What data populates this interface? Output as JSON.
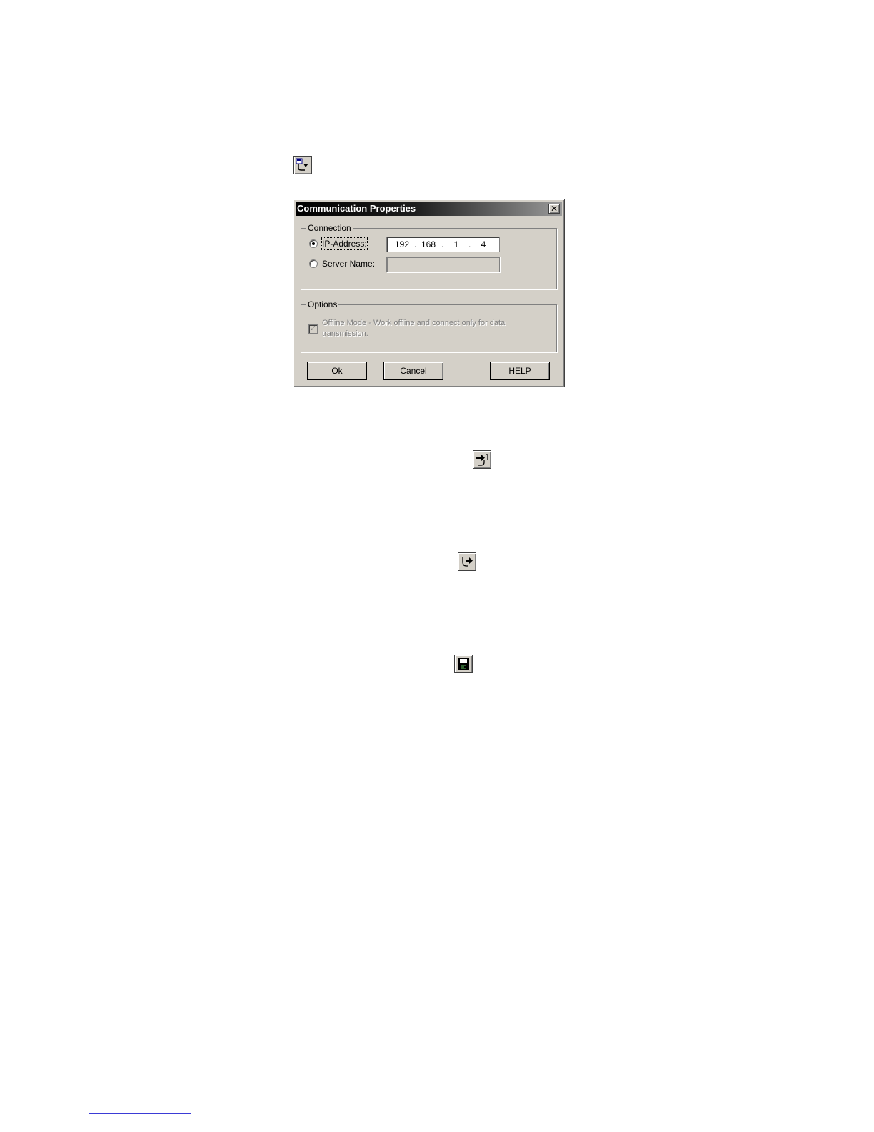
{
  "icons": {
    "communication_properties": "network-settings-icon",
    "connect": "connect-arrow-icon",
    "disconnect": "disconnect-arrow-icon",
    "save": "floppy-disk-icon"
  },
  "dialog": {
    "title": "Communication Properties",
    "close_glyph": "✕",
    "connection": {
      "legend": "Connection",
      "ip_label": "IP-Address:",
      "ip_octets": [
        "192",
        "168",
        "1",
        "4"
      ],
      "ip_separator": ".",
      "server_label": "Server Name:",
      "server_value": ""
    },
    "options": {
      "legend": "Options",
      "offline_line1": "Offline Mode - Work offline and connect only for data",
      "offline_line2": "transmission.",
      "check_glyph": "✓"
    },
    "buttons": {
      "ok": "Ok",
      "cancel": "Cancel",
      "help": "HELP"
    }
  }
}
